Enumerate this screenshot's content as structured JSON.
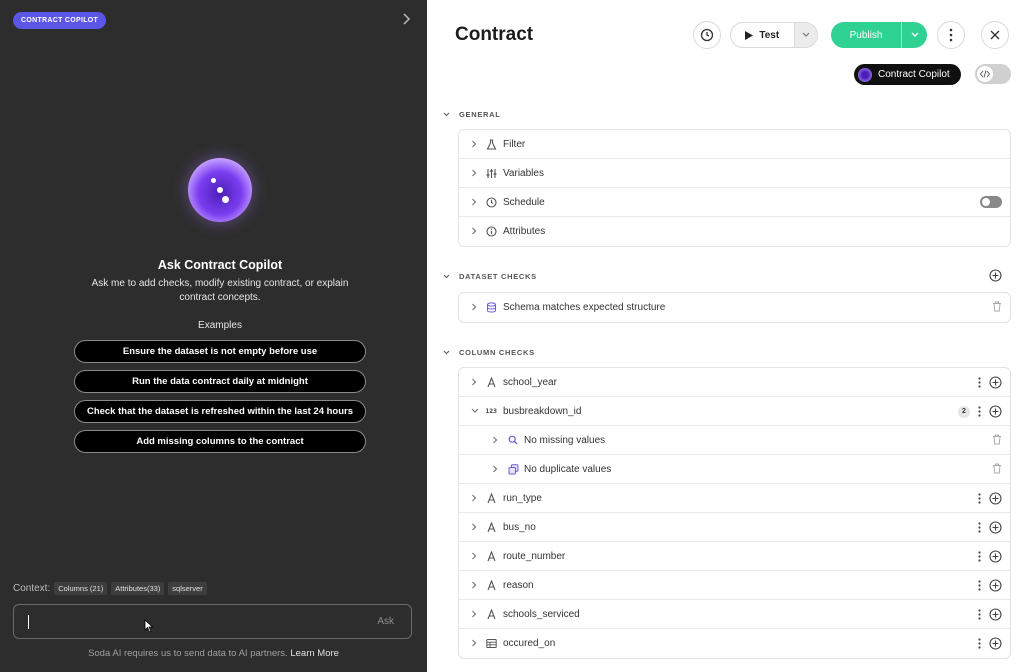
{
  "copilot_panel": {
    "badge": "CONTRACT COPILOT",
    "title": "Ask Contract Copilot",
    "description": "Ask me to add checks, modify existing contract, or explain contract concepts.",
    "examples_label": "Examples",
    "examples": [
      "Ensure the dataset is not empty before use",
      "Run the data contract daily at midnight",
      "Check that the dataset is refreshed within the last 24 hours",
      "Add missing columns to the contract"
    ],
    "context_label": "Context:",
    "context_chips": [
      "Columns (21)",
      "Attributes(33)",
      "sqlserver"
    ],
    "input_placeholder": "",
    "ask_label": "Ask",
    "footer_text": "Soda AI requires us to send data to AI partners.",
    "footer_link": "Learn More"
  },
  "header": {
    "title": "Contract",
    "test_label": "Test",
    "publish_label": "Publish",
    "copilot_label": "Contract Copilot"
  },
  "sections": {
    "general": {
      "title": "GENERAL",
      "items": [
        {
          "label": "Filter",
          "icon": "filter-flask-icon"
        },
        {
          "label": "Variables",
          "icon": "sliders-icon"
        },
        {
          "label": "Schedule",
          "icon": "clock-icon"
        },
        {
          "label": "Attributes",
          "icon": "info-icon"
        }
      ]
    },
    "dataset_checks": {
      "title": "DATASET CHECKS",
      "items": [
        {
          "label": "Schema matches expected structure",
          "icon": "database-icon"
        }
      ]
    },
    "column_checks": {
      "title": "COLUMN CHECKS",
      "columns": [
        {
          "label": "school_year",
          "type": "text"
        },
        {
          "label": "busbreakdown_id",
          "type": "123",
          "count": "2",
          "checks": [
            "No missing values",
            "No duplicate values"
          ]
        },
        {
          "label": "run_type",
          "type": "text"
        },
        {
          "label": "bus_no",
          "type": "text"
        },
        {
          "label": "route_number",
          "type": "text"
        },
        {
          "label": "reason",
          "type": "text"
        },
        {
          "label": "schools_serviced",
          "type": "text"
        },
        {
          "label": "occured_on",
          "type": "table"
        }
      ]
    }
  },
  "colors": {
    "badge": "#5b56e6",
    "publish": "#2fd293",
    "left_bg": "#2d2d2d"
  }
}
